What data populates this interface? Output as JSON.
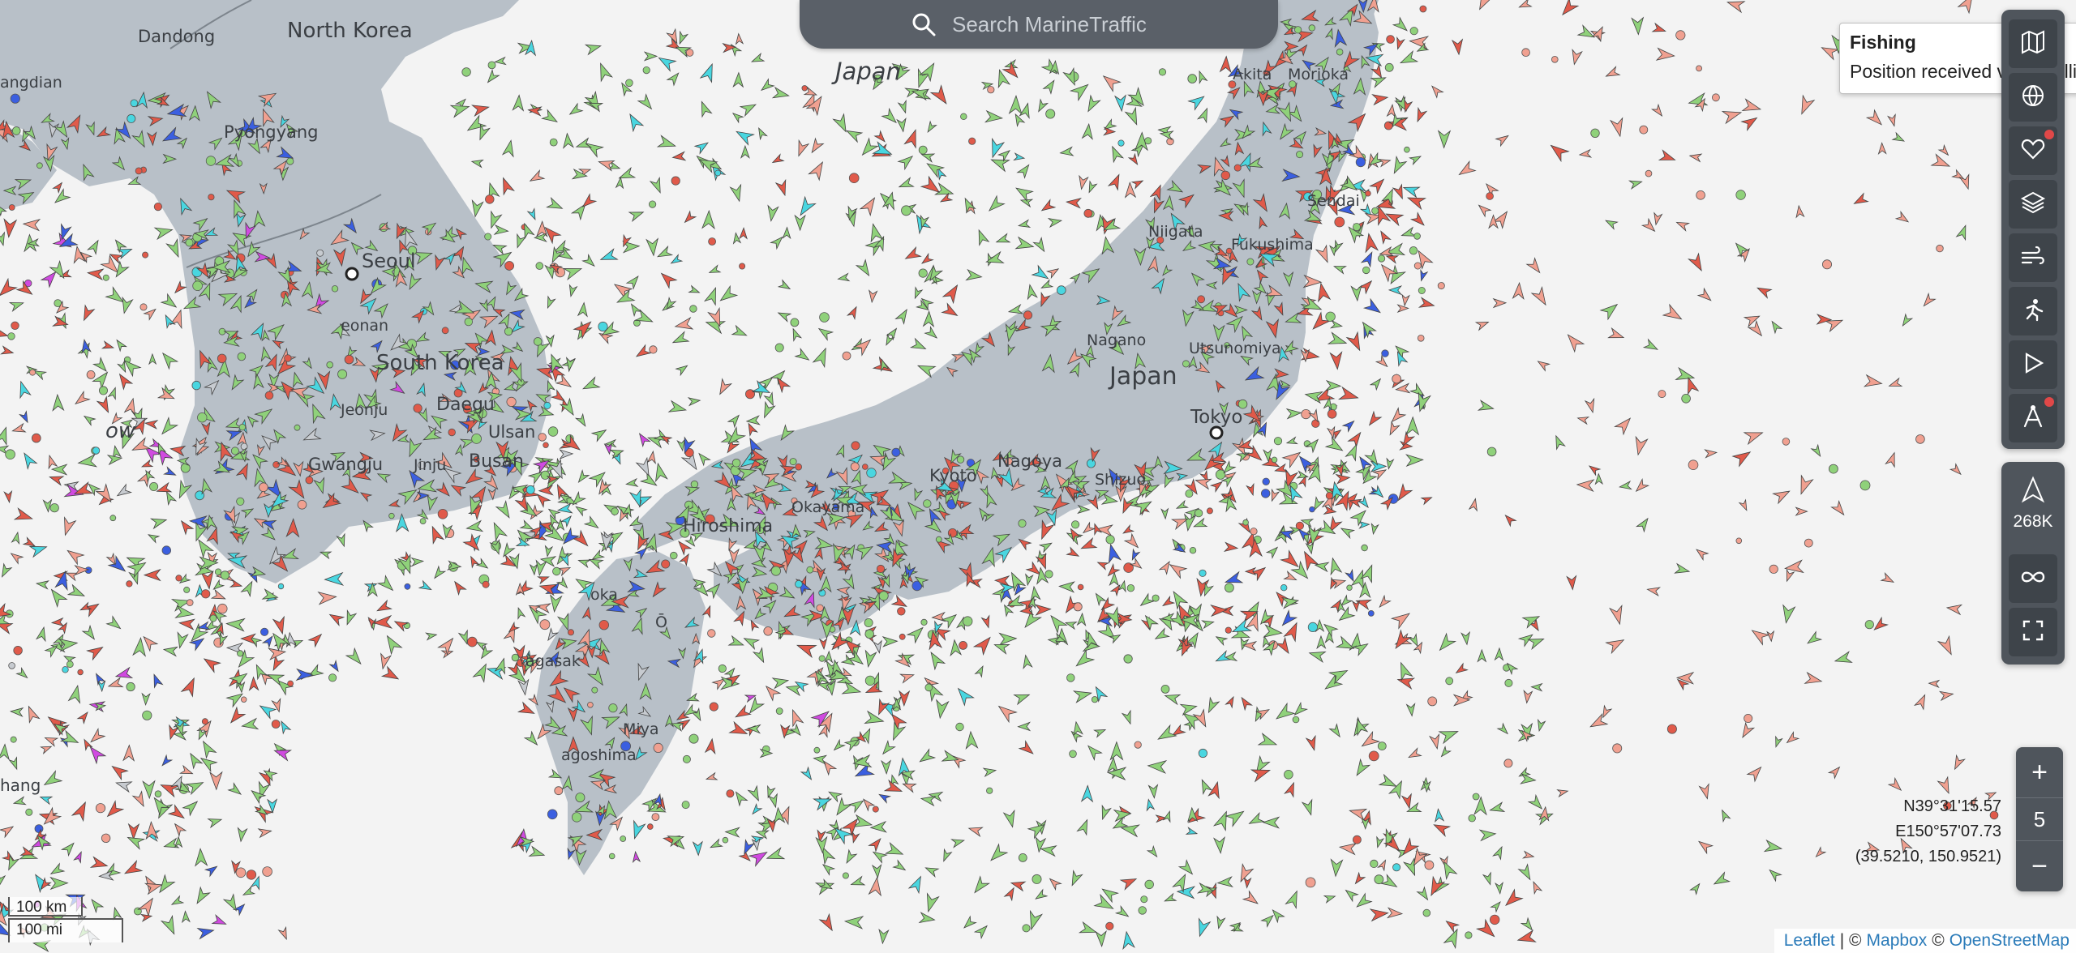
{
  "search": {
    "placeholder": "Search MarineTraffic"
  },
  "labels": {
    "sea_of_japan": "Japan",
    "countries": {
      "north_korea": "North Korea",
      "south_korea": "South Korea",
      "japan": "Japan"
    },
    "cities": {
      "dandong": "Dandong",
      "pyongyang": "Pyongyang",
      "seoul": "Seoul",
      "daegu": "Daegu",
      "jeonju": "Jeonju",
      "gwangju": "Gwangju",
      "busan": "Busan",
      "ulsan": "Ulsan",
      "akita": "Akita",
      "morioka": "Morioka",
      "sendai": "Sendai",
      "fukushima": "Fukushima",
      "niigata": "Niigata",
      "nagano": "Nagano",
      "utsunomiya": "Utsunomiya",
      "tokyo": "Tokyo",
      "nagoya": "Nagoya",
      "kyoto": "Kyoto",
      "okayama": "Okayama",
      "hiroshima": "Hiroshima",
      "shizuoka": "Shizuo",
      "kagoshima": "agoshima",
      "nagasaki": "agasak",
      "miyazaki": "Miya",
      "fukuoka": "oka",
      "oita": "Ō",
      "incheon": "eonan",
      "jinju": "Jinju",
      "yellow": "ow",
      "dandian": "angdian",
      "shanghai": "hang"
    }
  },
  "tooltip": {
    "title": "Fishing",
    "body": "Position received via Satellite"
  },
  "toolbar": {
    "buttons": [
      "map-icon",
      "globe-icon",
      "heart-icon",
      "layers-icon",
      "wind-icon",
      "route-icon",
      "play-icon",
      "measure-icon"
    ],
    "vessel_count": "268K"
  },
  "zoom": {
    "in": "+",
    "level": "5",
    "out": "−"
  },
  "coords": {
    "lat": "N39°31'15.57",
    "lon": "E150°57'07.73",
    "decimal": "(39.5210, 150.9521)"
  },
  "scale": {
    "km": "100 km",
    "mi": "100 mi"
  },
  "attribution": {
    "leaflet": "Leaflet",
    "sep": "| ©",
    "mapbox": "Mapbox",
    "sep2": "©",
    "osm": "OpenStreetMap"
  },
  "colors": {
    "sea": "#f3f3f3",
    "land": "#b8c0c8",
    "cargo": "#8fd17a",
    "tanker": "#e05a4a",
    "passenger": "#3b5fe0",
    "fishing": "#f0a090",
    "tug": "#49d6e0",
    "pleasure": "#d04ae0",
    "other": "#c7cbd0"
  }
}
